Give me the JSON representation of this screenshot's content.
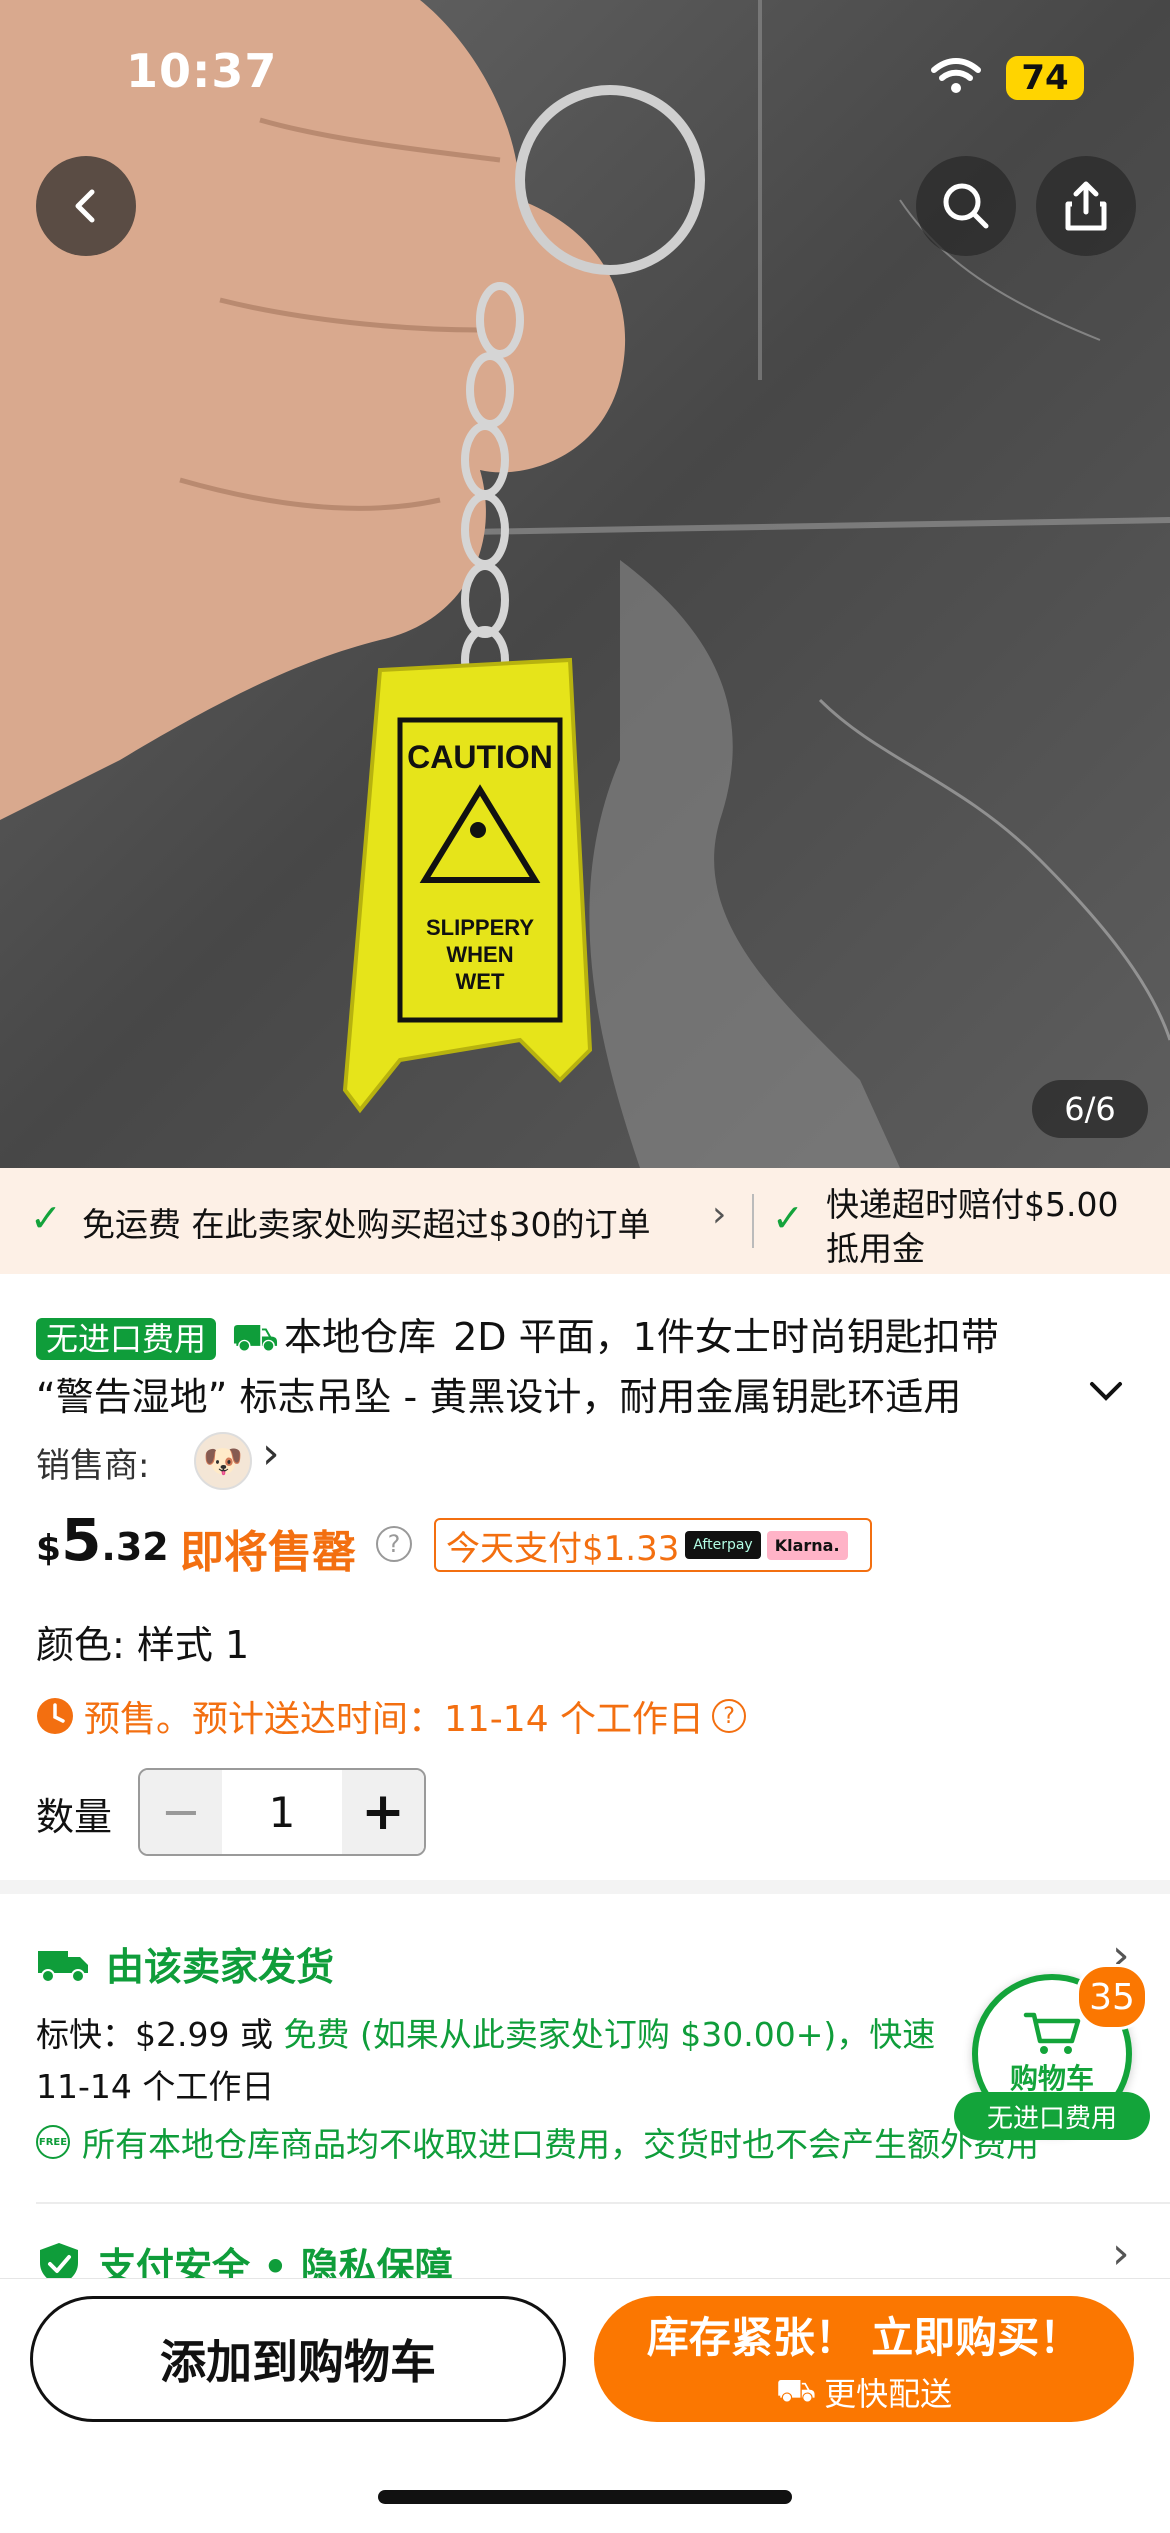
{
  "status_bar": {
    "time": "10:37",
    "battery": "74"
  },
  "gallery": {
    "counter": "6/6",
    "keychain_text": [
      "CAUTION",
      "SLIPPERY",
      "WHEN",
      "WET"
    ]
  },
  "shipping_banner": {
    "item1": "免运费 在此卖家处购买超过$30的订单",
    "item2_line1": "快递超时赔付$5.00",
    "item2_line2": "抵用金"
  },
  "product": {
    "badge": "无进口费用",
    "warehouse": "本地仓库",
    "title_line1": "2D 平面，1件女士时尚钥匙扣带",
    "title_line2": "“警告湿地” 标志吊坠 - 黄黑设计，耐用金属钥匙环适用",
    "seller_label": "销售商:",
    "price_currency": "$",
    "price_int": "5",
    "price_dec": ".32",
    "sellout": "即将售罄",
    "pay_today": "今天支付$1.33",
    "afterpay": "Afterpay",
    "klarna": "Klarna.",
    "color_label": "颜色: 样式 1",
    "presale": "预售。预计送达时间：11-14 个工作日",
    "qty_label": "数量",
    "qty_minus": "−",
    "qty_value": "1",
    "qty_plus": "+"
  },
  "shipping_info": {
    "title": "由该卖家发货",
    "line1_prefix": "标快：$2.99 或 ",
    "line1_free": "免费 (如果从此卖家处订购 $30.00+)，快速",
    "line2": "11-14 个工作日",
    "note_free": "FREE",
    "note": "所有本地仓库商品均不收取进口费用，交货时也不会产生额外费用"
  },
  "security": {
    "title": "支付安全 • 隐私保障"
  },
  "cart_float": {
    "count": "35",
    "label": "购物车",
    "tag": "无进口费用"
  },
  "actions": {
    "add_to_cart": "添加到购物车",
    "buy_now": "库存紧张！ 立即购买！",
    "buy_now_sub": "更快配送"
  },
  "colors": {
    "brand_orange": "#fb7701",
    "brand_green": "#0f9d3a"
  }
}
